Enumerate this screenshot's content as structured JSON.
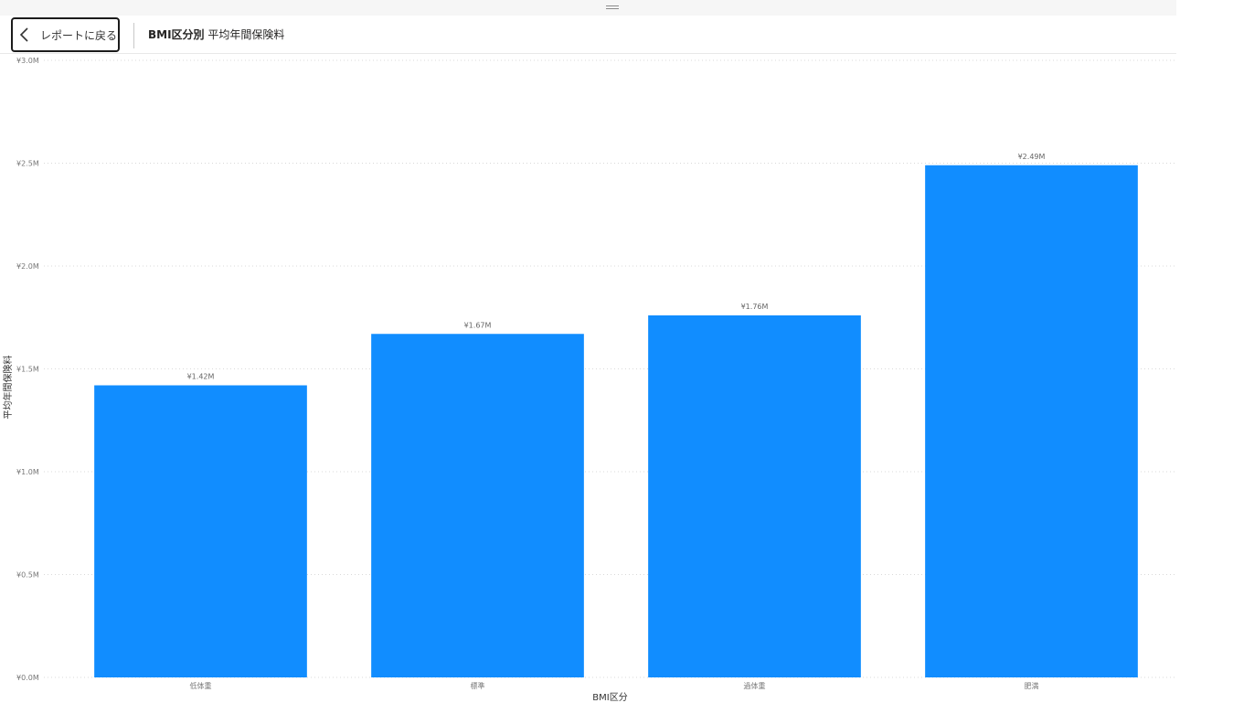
{
  "header": {
    "back_label": "レポートに戻る",
    "title_bold": "BMI区分別",
    "title_rest": " 平均年間保険料"
  },
  "icons": {
    "back": "chevron-left-icon",
    "drag_handle": "drag-handle-icon"
  },
  "colors": {
    "bar": "#118DFF",
    "grid": "#d9d9d9"
  },
  "chart_data": {
    "type": "bar",
    "categories": [
      "低体重",
      "標準",
      "過体重",
      "肥満"
    ],
    "values": [
      1.42,
      1.67,
      1.76,
      2.49
    ],
    "data_labels": [
      "¥1.42M",
      "¥1.67M",
      "¥1.76M",
      "¥2.49M"
    ],
    "xlabel": "BMI区分",
    "ylabel": "平均年間保険料",
    "ylim": [
      0,
      3.0
    ],
    "y_ticks": [
      0,
      0.5,
      1.0,
      1.5,
      2.0,
      2.5,
      3.0
    ],
    "y_tick_labels": [
      "¥0.0M",
      "¥0.5M",
      "¥1.0M",
      "¥1.5M",
      "¥2.0M",
      "¥2.5M",
      "¥3.0M"
    ],
    "grid": true,
    "legend": "none"
  }
}
